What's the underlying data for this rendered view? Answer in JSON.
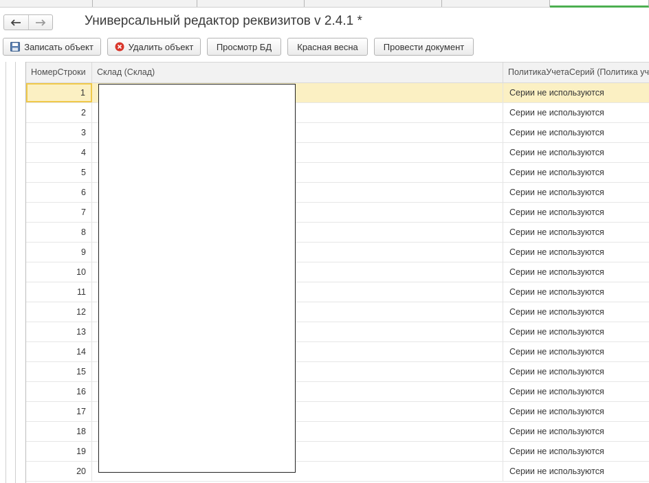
{
  "window": {
    "title": "Универсальный редактор реквизитов v 2.4.1 *"
  },
  "toolbar": {
    "save_label": "Записать объект",
    "delete_label": "Удалить объект",
    "db_view_label": "Просмотр БД",
    "red_spring_label": "Красная весна",
    "post_label": "Провести документ"
  },
  "colors": {
    "selected_row": "#fbf0c3",
    "selected_cell_border": "#f0c94a",
    "active_tab_accent": "#4caf50",
    "delete_icon": "#d9362b"
  },
  "table": {
    "columns": [
      "НомерСтроки",
      "Склад (Склад)",
      "ПолитикаУчетаСерий (Политика уч"
    ],
    "selected_row_index": 0,
    "rows": [
      {
        "num": "1",
        "policy": "Серии не используются"
      },
      {
        "num": "2",
        "policy": "Серии не используются"
      },
      {
        "num": "3",
        "policy": "Серии не используются"
      },
      {
        "num": "4",
        "policy": "Серии не используются"
      },
      {
        "num": "5",
        "policy": "Серии не используются"
      },
      {
        "num": "6",
        "policy": "Серии не используются"
      },
      {
        "num": "7",
        "policy": "Серии не используются"
      },
      {
        "num": "8",
        "policy": "Серии не используются"
      },
      {
        "num": "9",
        "policy": "Серии не используются"
      },
      {
        "num": "10",
        "policy": "Серии не используются"
      },
      {
        "num": "11",
        "policy": "Серии не используются"
      },
      {
        "num": "12",
        "policy": "Серии не используются"
      },
      {
        "num": "13",
        "policy": "Серии не используются"
      },
      {
        "num": "14",
        "policy": "Серии не используются"
      },
      {
        "num": "15",
        "policy": "Серии не используются"
      },
      {
        "num": "16",
        "policy": "Серии не используются"
      },
      {
        "num": "17",
        "policy": "Серии не используются"
      },
      {
        "num": "18",
        "policy": "Серии не используются"
      },
      {
        "num": "19",
        "policy": "Серии не используются"
      },
      {
        "num": "20",
        "policy": "Серии не используются"
      }
    ]
  }
}
